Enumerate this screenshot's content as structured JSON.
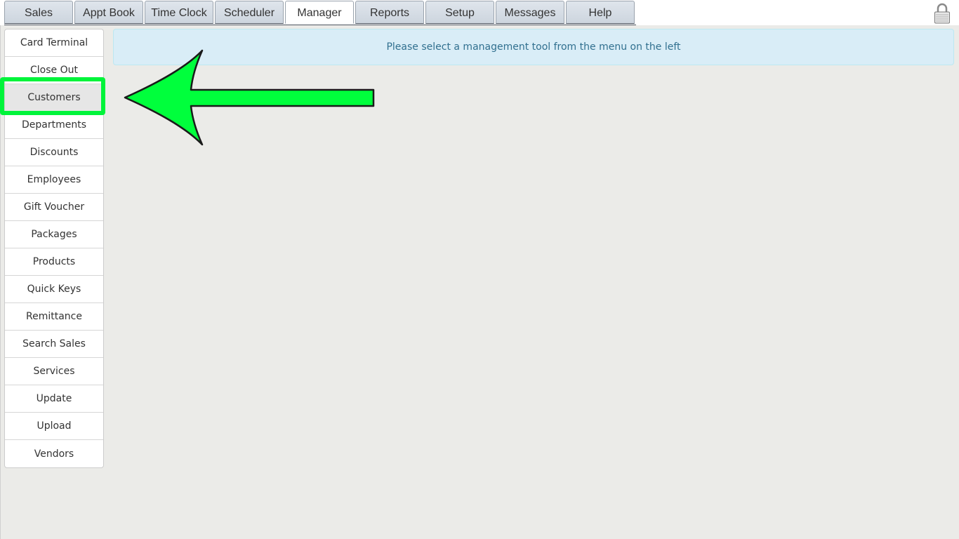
{
  "tabs": [
    {
      "label": "Sales"
    },
    {
      "label": "Appt Book"
    },
    {
      "label": "Time Clock"
    },
    {
      "label": "Scheduler"
    },
    {
      "label": "Manager"
    },
    {
      "label": "Reports"
    },
    {
      "label": "Setup"
    },
    {
      "label": "Messages"
    },
    {
      "label": "Help"
    }
  ],
  "active_tab": "Manager",
  "lock_icon": "padlock-icon",
  "sidebar": {
    "items": [
      {
        "label": "Card Terminal"
      },
      {
        "label": "Close Out"
      },
      {
        "label": "Customers"
      },
      {
        "label": "Departments"
      },
      {
        "label": "Discounts"
      },
      {
        "label": "Employees"
      },
      {
        "label": "Gift Voucher"
      },
      {
        "label": "Packages"
      },
      {
        "label": "Products"
      },
      {
        "label": "Quick Keys"
      },
      {
        "label": "Remittance"
      },
      {
        "label": "Search Sales"
      },
      {
        "label": "Services"
      },
      {
        "label": "Update"
      },
      {
        "label": "Upload"
      },
      {
        "label": "Vendors"
      }
    ],
    "selected": "Customers"
  },
  "main": {
    "message": "Please select a management tool from the menu on the left"
  },
  "annotation": {
    "arrow_color": "#00ff3c",
    "highlight_color": "#00f43a"
  }
}
